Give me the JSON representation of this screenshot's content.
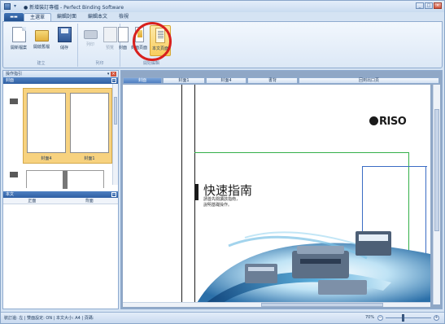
{
  "window": {
    "title": "● 新增裝訂專檔 - Perfect Binding Software",
    "quick_access": "▾",
    "controls": [
      "_",
      "□",
      "×"
    ]
  },
  "ribbon": {
    "app_menu_label": "▬▬",
    "tabs": [
      "主選單",
      "編輯封面",
      "編輯本文",
      "檢視"
    ],
    "active_tab": 0,
    "groups": [
      {
        "label": "建立",
        "buttons": [
          "開新檔案",
          "開啟舊檔",
          "儲存"
        ]
      },
      {
        "label": "列印",
        "buttons": [
          "列印",
          "預覽"
        ]
      },
      {
        "label": "開始編輯",
        "buttons": [
          "封面",
          "封面頁面",
          "本文頁面"
        ]
      }
    ]
  },
  "left_pane": {
    "title": "操作指引",
    "pin": "▾",
    "close": "×",
    "cover_section": "封面",
    "cover_pages": [
      "封面4",
      "封面1"
    ],
    "body_section": "本文",
    "body_columns": [
      "正面",
      "背面"
    ]
  },
  "document": {
    "tabs": [
      "封面",
      "封面1",
      "封面4",
      "書背",
      "回到出口頁"
    ],
    "active_tab": 0,
    "logo": "RISO",
    "heading": "快速指南",
    "subtitle_lines": [
      "請首先閱讀該指南，",
      "說明基礎操作。"
    ]
  },
  "status_bar": {
    "text": "裝訂邊: 左  |  雙面設定: ON  |  本文大小: A4  |  頁碼:",
    "zoom_label": "70%",
    "zoom_level": 0.4
  },
  "colors": {
    "highlight_ring": "#d8201e",
    "accent_blue": "#2f5fa3",
    "green_frame": "#34b04a",
    "blue_frame": "#3b6cc4"
  }
}
